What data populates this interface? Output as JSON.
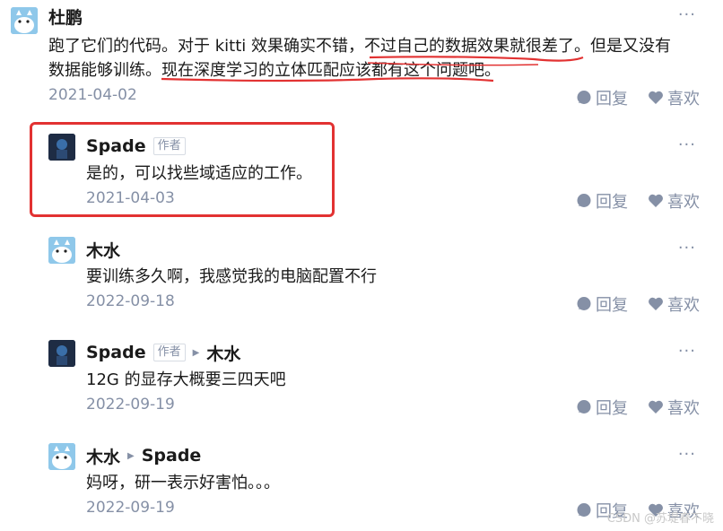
{
  "comments": [
    {
      "author": "杜鹏",
      "badge": "",
      "reply_to": "",
      "content_lines": [
        "跑了它们的代码。对于 kitti 效果确实不错，不过自己的数据效果就很差了。但是又没有",
        "数据能够训练。现在深度学习的立体匹配应该都有这个问题吧。"
      ],
      "date": "2021-04-02",
      "reply_label": "回复",
      "like_label": "喜欢",
      "avatar": "cat-avatar"
    },
    {
      "author": "Spade",
      "badge": "作者",
      "reply_to": "",
      "content_lines": [
        "是的，可以找些域适应的工作。"
      ],
      "date": "2021-04-03",
      "reply_label": "回复",
      "like_label": "喜欢",
      "avatar": "spade-avatar"
    },
    {
      "author": "木水",
      "badge": "",
      "reply_to": "",
      "content_lines": [
        "要训练多久啊，我感觉我的电脑配置不行"
      ],
      "date": "2022-09-18",
      "reply_label": "回复",
      "like_label": "喜欢",
      "avatar": "cat-avatar"
    },
    {
      "author": "Spade",
      "badge": "作者",
      "reply_to": "木水",
      "content_lines": [
        "12G 的显存大概要三四天吧"
      ],
      "date": "2022-09-19",
      "reply_label": "回复",
      "like_label": "喜欢",
      "avatar": "spade-avatar"
    },
    {
      "author": "木水",
      "badge": "",
      "reply_to": "Spade",
      "content_lines": [
        "妈呀，研一表示好害怕。。。"
      ],
      "date": "2022-09-19",
      "reply_label": "回复",
      "like_label": "喜欢",
      "avatar": "cat-avatar"
    }
  ],
  "more_label": "···",
  "watermark": "CSDN @苏堤春不晓",
  "colors": {
    "accent_red": "#e23232",
    "muted": "#8590a6",
    "text": "#1a1a1a"
  }
}
